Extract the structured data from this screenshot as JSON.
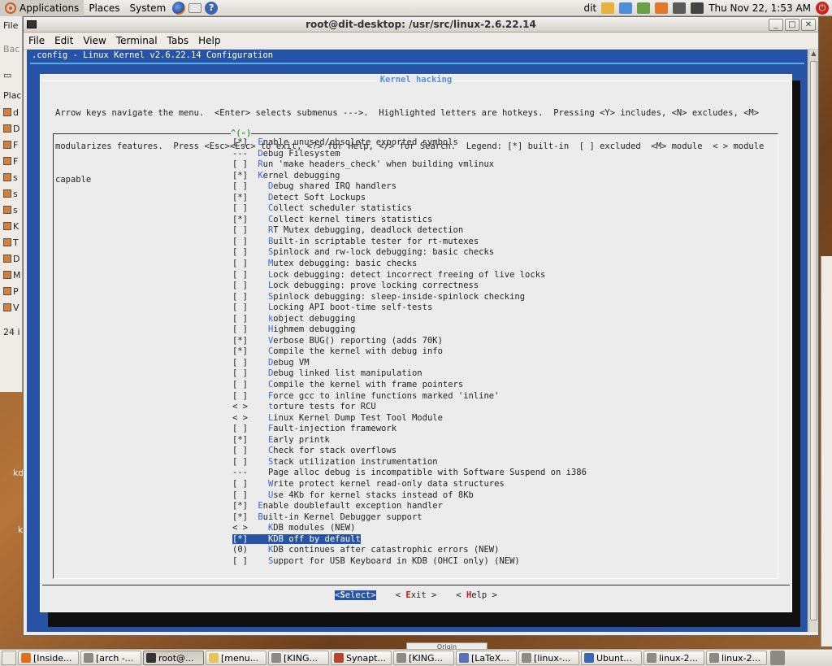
{
  "top_panel": {
    "menus": [
      "Applications",
      "Places",
      "System"
    ],
    "user": "dit",
    "clock": "Thu Nov 22,  1:53 AM"
  },
  "background_window": {
    "items": [
      "d",
      "D",
      "F",
      "F",
      "s",
      "s",
      "s",
      "K",
      "T",
      "D",
      "M",
      "P",
      "V"
    ],
    "status": "24 i",
    "nav_label": "Bac",
    "places_label": "Plac"
  },
  "desktop": {
    "labels": [
      "kd",
      "k"
    ]
  },
  "terminal": {
    "title": "root@dit-desktop: /usr/src/linux-2.6.22.14",
    "menu": [
      "File",
      "Edit",
      "View",
      "Terminal",
      "Tabs",
      "Help"
    ]
  },
  "menuconfig": {
    "config_title": ".config - Linux Kernel v2.6.22.14 Configuration",
    "dialog_title": "Kernel hacking",
    "help_lines": [
      "Arrow keys navigate the menu.  <Enter> selects submenus --->.  Highlighted letters are hotkeys.  Pressing <Y> includes, <N> excludes, <M>",
      "modularizes features.  Press <Esc><Esc> to exit, <?> for Help, </> for Search.  Legend: [*] built-in  [ ] excluded  <M> module  < > module",
      "capable"
    ],
    "scroll_indicator": "^(-)",
    "items": [
      {
        "state": "[*]",
        "hot": "E",
        "rest": "nable unused/obsolete exported symbols",
        "indent": ""
      },
      {
        "state": "---",
        "hot": "D",
        "rest": "ebug Filesystem",
        "indent": ""
      },
      {
        "state": "[ ]",
        "hot": "R",
        "rest": "un 'make headers_check' when building vmlinux",
        "indent": ""
      },
      {
        "state": "[*]",
        "hot": "K",
        "rest": "ernel debugging",
        "indent": ""
      },
      {
        "state": "[ ]",
        "hot": "D",
        "rest": "ebug shared IRQ handlers",
        "indent": "  "
      },
      {
        "state": "[*]",
        "hot": "D",
        "rest": "etect Soft Lockups",
        "indent": "  "
      },
      {
        "state": "[ ]",
        "hot": "C",
        "rest": "ollect scheduler statistics",
        "indent": "  "
      },
      {
        "state": "[*]",
        "hot": "C",
        "rest": "ollect kernel timers statistics",
        "indent": "  "
      },
      {
        "state": "[ ]",
        "hot": "R",
        "rest": "T Mutex debugging, deadlock detection",
        "indent": "  "
      },
      {
        "state": "[ ]",
        "hot": "B",
        "rest": "uilt-in scriptable tester for rt-mutexes",
        "indent": "  "
      },
      {
        "state": "[ ]",
        "hot": "S",
        "rest": "pinlock and rw-lock debugging: basic checks",
        "indent": "  "
      },
      {
        "state": "[ ]",
        "hot": "M",
        "rest": "utex debugging: basic checks",
        "indent": "  "
      },
      {
        "state": "[ ]",
        "hot": "L",
        "rest": "ock debugging: detect incorrect freeing of live locks",
        "indent": "  "
      },
      {
        "state": "[ ]",
        "hot": "L",
        "rest": "ock debugging: prove locking correctness",
        "indent": "  "
      },
      {
        "state": "[ ]",
        "hot": "S",
        "rest": "pinlock debugging: sleep-inside-spinlock checking",
        "indent": "  "
      },
      {
        "state": "[ ]",
        "hot": "L",
        "rest": "ocking API boot-time self-tests",
        "indent": "  "
      },
      {
        "state": "[ ]",
        "hot": "k",
        "rest": "object debugging",
        "indent": "  "
      },
      {
        "state": "[ ]",
        "hot": "H",
        "rest": "ighmem debugging",
        "indent": "  "
      },
      {
        "state": "[*]",
        "hot": "V",
        "rest": "erbose BUG() reporting (adds 70K)",
        "indent": "  "
      },
      {
        "state": "[*]",
        "hot": "C",
        "rest": "ompile the kernel with debug info",
        "indent": "  "
      },
      {
        "state": "[ ]",
        "hot": "D",
        "rest": "ebug VM",
        "indent": "  "
      },
      {
        "state": "[ ]",
        "hot": "D",
        "rest": "ebug linked list manipulation",
        "indent": "  "
      },
      {
        "state": "[ ]",
        "hot": "C",
        "rest": "ompile the kernel with frame pointers",
        "indent": "  "
      },
      {
        "state": "[ ]",
        "hot": "F",
        "rest": "orce gcc to inline functions marked 'inline'",
        "indent": "  "
      },
      {
        "state": "< >",
        "hot": "t",
        "rest": "orture tests for RCU",
        "indent": "  "
      },
      {
        "state": "< >",
        "hot": "L",
        "rest": "inux Kernel Dump Test Tool Module",
        "indent": "  "
      },
      {
        "state": "[ ]",
        "hot": "F",
        "rest": "ault-injection framework",
        "indent": "  "
      },
      {
        "state": "[*]",
        "hot": "E",
        "rest": "arly printk",
        "indent": "  "
      },
      {
        "state": "[ ]",
        "hot": "C",
        "rest": "heck for stack overflows",
        "indent": "  "
      },
      {
        "state": "[ ]",
        "hot": "S",
        "rest": "tack utilization instrumentation",
        "indent": "  "
      },
      {
        "state": "---",
        "hot": "",
        "rest": "Page alloc debug is incompatible with Software Suspend on i386",
        "indent": "  "
      },
      {
        "state": "[ ]",
        "hot": "W",
        "rest": "rite protect kernel read-only data structures",
        "indent": "  "
      },
      {
        "state": "[ ]",
        "hot": "U",
        "rest": "se 4Kb for kernel stacks instead of 8Kb",
        "indent": "  "
      },
      {
        "state": "[*]",
        "hot": "E",
        "rest": "nable doublefault exception handler",
        "indent": ""
      },
      {
        "state": "[*]",
        "hot": "B",
        "rest": "uilt-in Kernel Debugger support",
        "indent": ""
      },
      {
        "state": "< >",
        "hot": "K",
        "rest": "DB modules (NEW)",
        "indent": "  "
      },
      {
        "state": "[*]",
        "hot": "K",
        "rest": "DB off by default",
        "indent": "  ",
        "selected": true
      },
      {
        "state": "(0)",
        "hot": "K",
        "rest": "DB continues after catastrophic errors (NEW)",
        "indent": "  "
      },
      {
        "state": "[ ]",
        "hot": "S",
        "rest": "upport for USB Keyboard in KDB (OHCI only) (NEW)",
        "indent": "  "
      }
    ],
    "buttons": [
      {
        "pre": "<",
        "hot": "S",
        "post": "elect>",
        "active": true
      },
      {
        "pre": "< ",
        "hot": "E",
        "post": "xit >",
        "active": false
      },
      {
        "pre": "< ",
        "hot": "H",
        "post": "elp >",
        "active": false
      }
    ]
  },
  "taskbar": {
    "tasks": [
      {
        "label": "[Inside...",
        "icon_color": "#e0701d"
      },
      {
        "label": "[arch -...",
        "icon_color": "#8d8a84"
      },
      {
        "label": "root@...",
        "icon_color": "#333333",
        "active": true
      },
      {
        "label": "[menu...",
        "icon_color": "#e7c35b"
      },
      {
        "label": "[KING...",
        "icon_color": "#8d8a84"
      },
      {
        "label": "Synapt...",
        "icon_color": "#b8452c"
      },
      {
        "label": "[KING...",
        "icon_color": "#8d8a84"
      },
      {
        "label": "[LaTeX...",
        "icon_color": "#5b6fb8"
      },
      {
        "label": "[linux-...",
        "icon_color": "#8d8a84"
      },
      {
        "label": "Ubunt...",
        "icon_color": "#3a66b5"
      },
      {
        "label": "linux-2...",
        "icon_color": "#8d8a84"
      },
      {
        "label": "linux-2...",
        "icon_color": "#8d8a84"
      }
    ],
    "peek_label": "Origin"
  }
}
